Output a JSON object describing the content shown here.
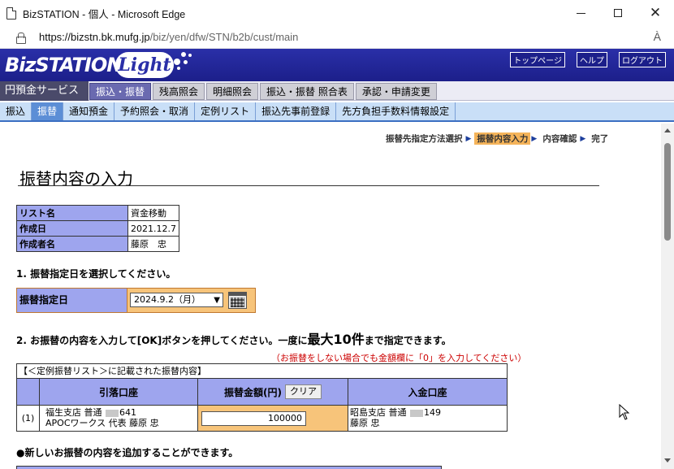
{
  "window": {
    "title": "BizSTATION - 個人 - Microsoft Edge",
    "minimize": "—",
    "maximize": "□",
    "close": "✕"
  },
  "address": {
    "host": "https://bizstn.bk.mufg.jp",
    "path": "/biz/yen/dfw/STN/b2b/cust/main",
    "read_aloud": "À"
  },
  "header": {
    "logo_text": "BizSTATION",
    "logo_light": "Light",
    "links": [
      "トップページ",
      "ヘルプ",
      "ログアウト"
    ]
  },
  "service": {
    "label": "円預金サービス",
    "tabs": [
      "振込・振替",
      "残高照会",
      "明細照会",
      "振込・振替 照合表",
      "承認・申請変更"
    ],
    "active_tab": 0
  },
  "subnav": {
    "items": [
      "振込",
      "振替",
      "通知預金",
      "予約照会・取消",
      "定例リスト",
      "振込先事前登録",
      "先方負担手数料情報設定"
    ],
    "active": 1
  },
  "steps": [
    "振替先指定方法選択",
    "振替内容入力",
    "内容確認",
    "完了"
  ],
  "page": {
    "title": "振替内容の入力"
  },
  "info": [
    {
      "label": "リスト名",
      "value": "資金移動"
    },
    {
      "label": "作成日",
      "value": "2021.12.7"
    },
    {
      "label": "作成者名",
      "value": "藤原　忠"
    }
  ],
  "section1": "1. 振替指定日を選択してください。",
  "date": {
    "label": "振替指定日",
    "selected": "2024.9.2（月）"
  },
  "section2": {
    "pre": "2. お振替の内容を入力して[OK]ボタンを押してください。一度に",
    "big": "最大10件",
    "post": "まで指定できます。"
  },
  "note": "（お振替をしない場合でも金額欄に「0」を入力してください）",
  "transfer": {
    "caption": "【＜定例振替リスト＞に記載された振替内容】",
    "headers": [
      "引落口座",
      "振替金額(円)",
      "入金口座"
    ],
    "clear_label": "クリア",
    "rows": [
      {
        "no": "(1)",
        "from_line1_pre": "福生支店 普通 ",
        "from_line1_post": "641",
        "from_line2": "APOCワークス 代表 藤原 忠",
        "amount": "100000",
        "to_line1_pre": "昭島支店 普通 ",
        "to_line1_post": "149",
        "to_line2": "藤原 忠"
      }
    ]
  },
  "section3": "●新しいお振替の内容を追加することができます。",
  "colors": {
    "header_blue": "#2a2fa8",
    "label_purple": "#9ea5ee",
    "input_orange": "#f7c47a",
    "subnav_blue": "#c9dff7",
    "note_red": "#cc0000"
  }
}
